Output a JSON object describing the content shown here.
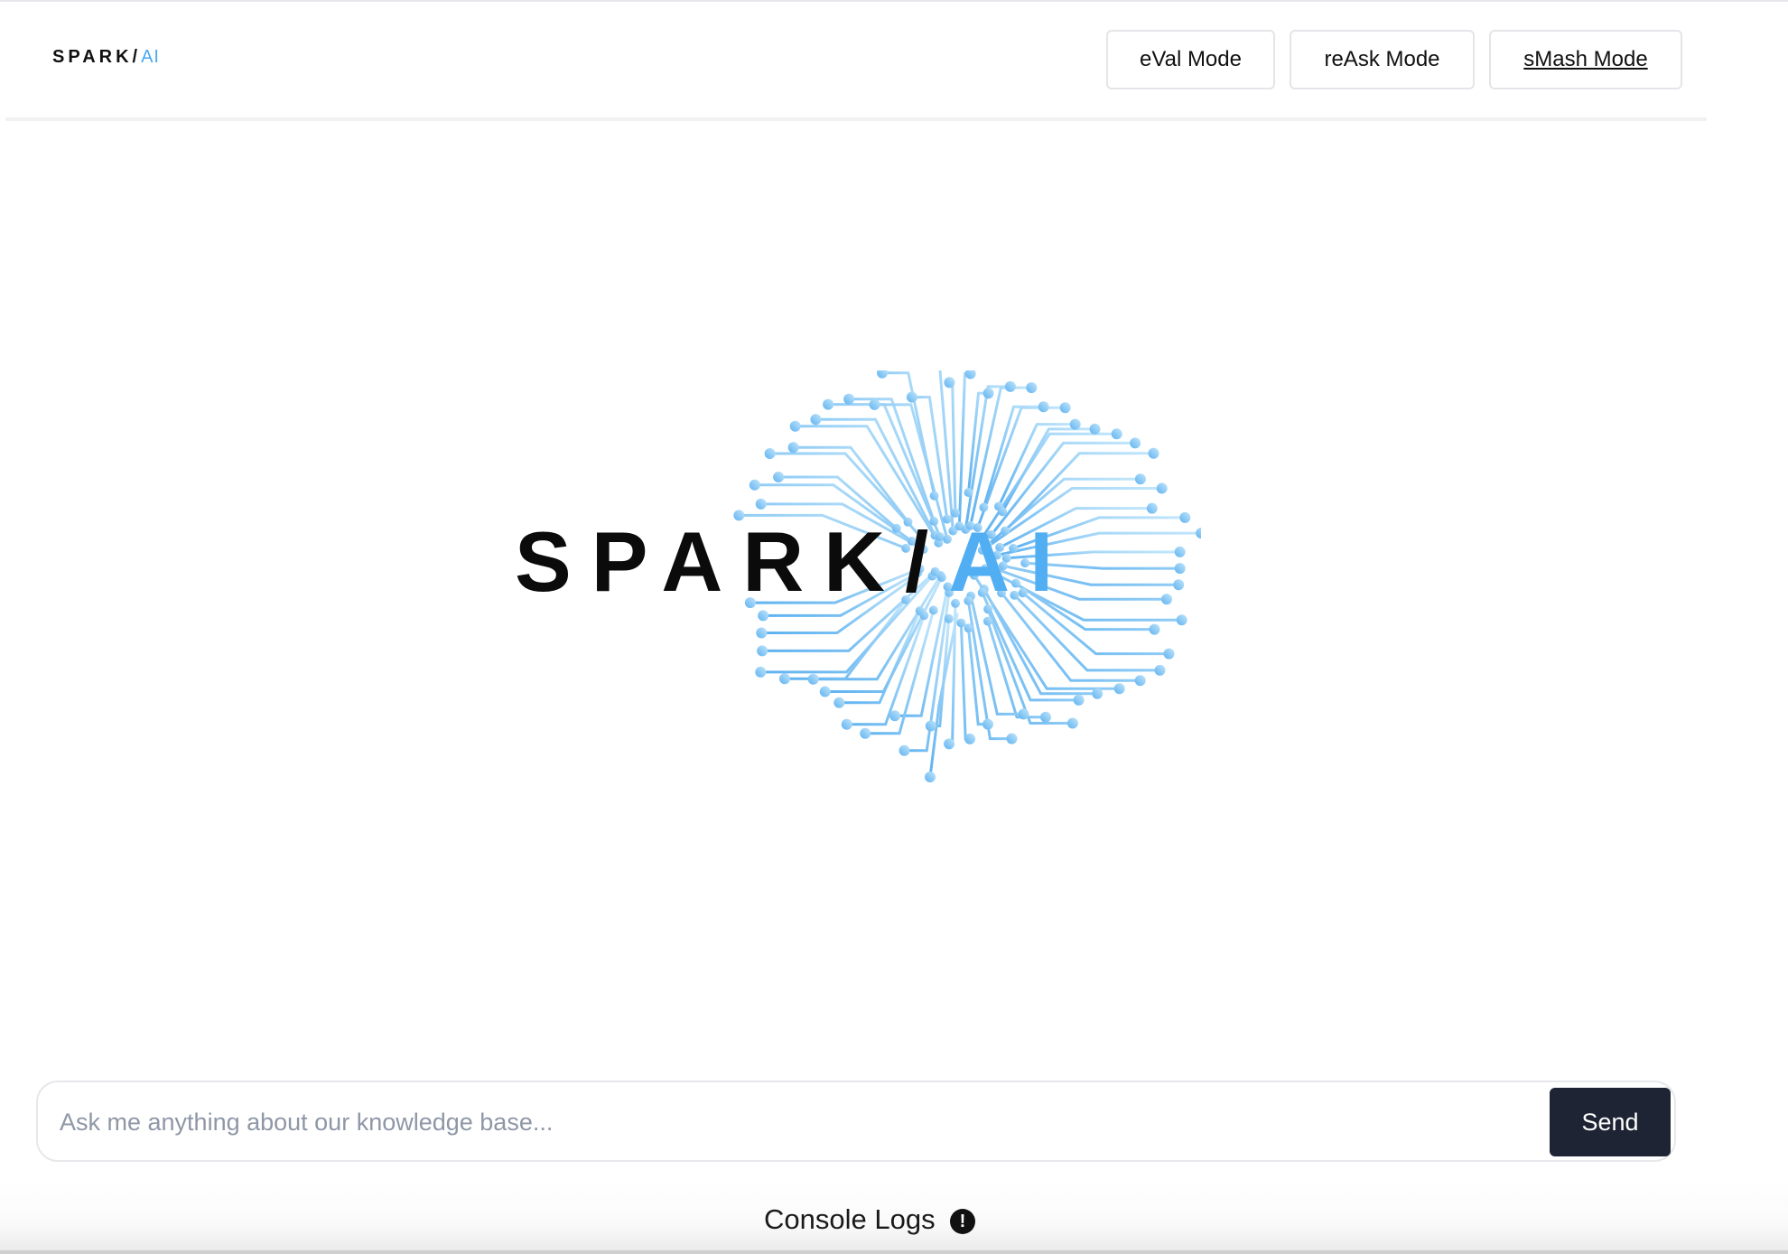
{
  "header": {
    "brand_main": "SPARK/",
    "brand_accent": "AI",
    "modes": [
      {
        "label": "eVal Mode"
      },
      {
        "label": "reAsk Mode"
      },
      {
        "label": "sMash Mode",
        "active": true
      }
    ]
  },
  "hero": {
    "brand_main": "SPARK/",
    "brand_accent": "AI",
    "graphic": "circuit-brain-icon"
  },
  "chat": {
    "placeholder": "Ask me anything about our knowledge base...",
    "value": "",
    "send_label": "Send"
  },
  "console": {
    "label": "Console Logs",
    "icon": "alert-circle-icon",
    "icon_glyph": "!"
  },
  "colors": {
    "accent": "#4aa8f2",
    "circuit_light": "#c2e6fb",
    "circuit_dark": "#5fb2f0",
    "send_button": "#1e2433",
    "brand_text": "#0b0b0b"
  }
}
